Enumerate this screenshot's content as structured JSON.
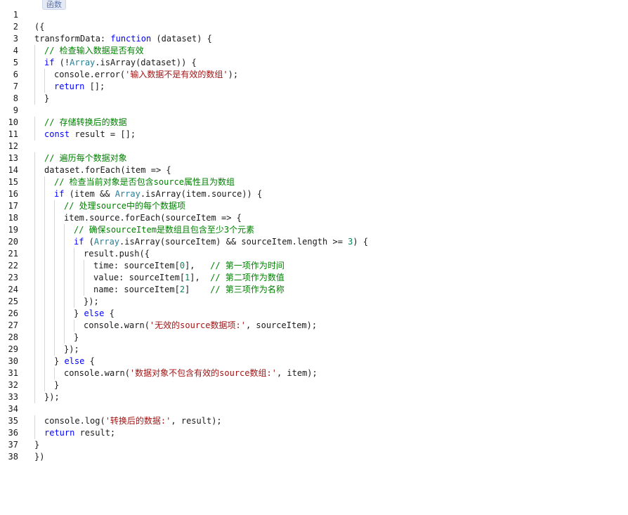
{
  "header": {
    "tag_label": "函数"
  },
  "editor": {
    "lines": [
      {
        "n": "1",
        "indent": 0,
        "tokens": []
      },
      {
        "n": "2",
        "indent": 0,
        "tokens": [
          {
            "t": "({",
            "c": ""
          }
        ]
      },
      {
        "n": "3",
        "indent": 0,
        "tokens": [
          {
            "t": "transformData: ",
            "c": ""
          },
          {
            "t": "function",
            "c": "kw"
          },
          {
            "t": " (dataset) {",
            "c": ""
          }
        ]
      },
      {
        "n": "4",
        "indent": 1,
        "tokens": [
          {
            "t": "// 检查输入数据是否有效",
            "c": "cm"
          }
        ]
      },
      {
        "n": "5",
        "indent": 1,
        "tokens": [
          {
            "t": "if",
            "c": "kw"
          },
          {
            "t": " (!",
            "c": ""
          },
          {
            "t": "Array",
            "c": "bi"
          },
          {
            "t": ".isArray(dataset)) {",
            "c": ""
          }
        ]
      },
      {
        "n": "6",
        "indent": 2,
        "tokens": [
          {
            "t": "console.error(",
            "c": ""
          },
          {
            "t": "'输入数据不是有效的数组'",
            "c": "st"
          },
          {
            "t": ");",
            "c": ""
          }
        ]
      },
      {
        "n": "7",
        "indent": 2,
        "tokens": [
          {
            "t": "return",
            "c": "kw"
          },
          {
            "t": " [];",
            "c": ""
          }
        ]
      },
      {
        "n": "8",
        "indent": 1,
        "tokens": [
          {
            "t": "}",
            "c": ""
          }
        ]
      },
      {
        "n": "9",
        "indent": 0,
        "tokens": []
      },
      {
        "n": "10",
        "indent": 1,
        "tokens": [
          {
            "t": "// 存储转换后的数据",
            "c": "cm"
          }
        ]
      },
      {
        "n": "11",
        "indent": 1,
        "tokens": [
          {
            "t": "const",
            "c": "kw"
          },
          {
            "t": " result = [];",
            "c": ""
          }
        ]
      },
      {
        "n": "12",
        "indent": 0,
        "tokens": []
      },
      {
        "n": "13",
        "indent": 1,
        "tokens": [
          {
            "t": "// 遍历每个数据对象",
            "c": "cm"
          }
        ]
      },
      {
        "n": "14",
        "indent": 1,
        "tokens": [
          {
            "t": "dataset.forEach(item => {",
            "c": ""
          }
        ]
      },
      {
        "n": "15",
        "indent": 2,
        "tokens": [
          {
            "t": "// 检查当前对象是否包含source属性且为数组",
            "c": "cm"
          }
        ]
      },
      {
        "n": "16",
        "indent": 2,
        "tokens": [
          {
            "t": "if",
            "c": "kw"
          },
          {
            "t": " (item && ",
            "c": ""
          },
          {
            "t": "Array",
            "c": "bi"
          },
          {
            "t": ".isArray(item.source)) {",
            "c": ""
          }
        ]
      },
      {
        "n": "17",
        "indent": 3,
        "tokens": [
          {
            "t": "// 处理source中的每个数据项",
            "c": "cm"
          }
        ]
      },
      {
        "n": "18",
        "indent": 3,
        "tokens": [
          {
            "t": "item.source.forEach(sourceItem => {",
            "c": ""
          }
        ]
      },
      {
        "n": "19",
        "indent": 4,
        "tokens": [
          {
            "t": "// 确保sourceItem是数组且包含至少3个元素",
            "c": "cm"
          }
        ]
      },
      {
        "n": "20",
        "indent": 4,
        "tokens": [
          {
            "t": "if",
            "c": "kw"
          },
          {
            "t": " (",
            "c": ""
          },
          {
            "t": "Array",
            "c": "bi"
          },
          {
            "t": ".isArray(sourceItem) && sourceItem.length >= ",
            "c": ""
          },
          {
            "t": "3",
            "c": "nu"
          },
          {
            "t": ") {",
            "c": ""
          }
        ]
      },
      {
        "n": "21",
        "indent": 5,
        "tokens": [
          {
            "t": "result.push({",
            "c": ""
          }
        ]
      },
      {
        "n": "22",
        "indent": 6,
        "tokens": [
          {
            "t": "time: sourceItem[",
            "c": ""
          },
          {
            "t": "0",
            "c": "nu"
          },
          {
            "t": "],   ",
            "c": ""
          },
          {
            "t": "// 第一项作为时间",
            "c": "cm"
          }
        ]
      },
      {
        "n": "23",
        "indent": 6,
        "tokens": [
          {
            "t": "value: sourceItem[",
            "c": ""
          },
          {
            "t": "1",
            "c": "nu"
          },
          {
            "t": "],  ",
            "c": ""
          },
          {
            "t": "// 第二项作为数值",
            "c": "cm"
          }
        ]
      },
      {
        "n": "24",
        "indent": 6,
        "tokens": [
          {
            "t": "name: sourceItem[",
            "c": ""
          },
          {
            "t": "2",
            "c": "nu"
          },
          {
            "t": "]    ",
            "c": ""
          },
          {
            "t": "// 第三项作为名称",
            "c": "cm"
          }
        ]
      },
      {
        "n": "25",
        "indent": 5,
        "tokens": [
          {
            "t": "});",
            "c": ""
          }
        ]
      },
      {
        "n": "26",
        "indent": 4,
        "tokens": [
          {
            "t": "} ",
            "c": ""
          },
          {
            "t": "else",
            "c": "kw"
          },
          {
            "t": " {",
            "c": ""
          }
        ]
      },
      {
        "n": "27",
        "indent": 5,
        "tokens": [
          {
            "t": "console.warn(",
            "c": ""
          },
          {
            "t": "'无效的source数据项:'",
            "c": "st"
          },
          {
            "t": ", sourceItem);",
            "c": ""
          }
        ]
      },
      {
        "n": "28",
        "indent": 4,
        "tokens": [
          {
            "t": "}",
            "c": ""
          }
        ]
      },
      {
        "n": "29",
        "indent": 3,
        "tokens": [
          {
            "t": "});",
            "c": ""
          }
        ]
      },
      {
        "n": "30",
        "indent": 2,
        "tokens": [
          {
            "t": "} ",
            "c": ""
          },
          {
            "t": "else",
            "c": "kw"
          },
          {
            "t": " {",
            "c": ""
          }
        ]
      },
      {
        "n": "31",
        "indent": 3,
        "tokens": [
          {
            "t": "console.warn(",
            "c": ""
          },
          {
            "t": "'数据对象不包含有效的source数组:'",
            "c": "st"
          },
          {
            "t": ", item);",
            "c": ""
          }
        ]
      },
      {
        "n": "32",
        "indent": 2,
        "tokens": [
          {
            "t": "}",
            "c": ""
          }
        ]
      },
      {
        "n": "33",
        "indent": 1,
        "tokens": [
          {
            "t": "});",
            "c": ""
          }
        ]
      },
      {
        "n": "34",
        "indent": 0,
        "tokens": []
      },
      {
        "n": "35",
        "indent": 1,
        "tokens": [
          {
            "t": "console.log(",
            "c": ""
          },
          {
            "t": "'转换后的数据:'",
            "c": "st"
          },
          {
            "t": ", result);",
            "c": ""
          }
        ]
      },
      {
        "n": "36",
        "indent": 1,
        "tokens": [
          {
            "t": "return",
            "c": "kw"
          },
          {
            "t": " result;",
            "c": ""
          }
        ]
      },
      {
        "n": "37",
        "indent": 0,
        "tokens": [
          {
            "t": "}",
            "c": ""
          }
        ]
      },
      {
        "n": "38",
        "indent": 0,
        "tokens": [
          {
            "t": "})",
            "c": ""
          }
        ]
      }
    ]
  }
}
